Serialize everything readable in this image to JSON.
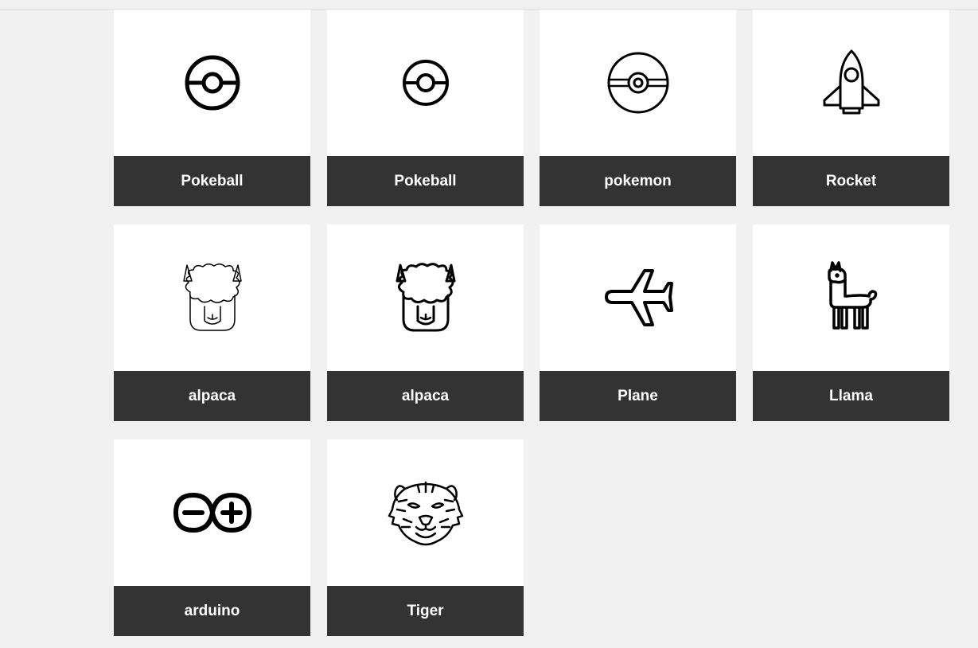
{
  "icons": [
    {
      "name": "Pokeball",
      "icon": "pokeball-icon"
    },
    {
      "name": "Pokeball",
      "icon": "pokeball-thin-icon"
    },
    {
      "name": "pokemon",
      "icon": "pokemon-ball-icon"
    },
    {
      "name": "Rocket",
      "icon": "rocket-icon"
    },
    {
      "name": "alpaca",
      "icon": "alpaca-thin-icon"
    },
    {
      "name": "alpaca",
      "icon": "alpaca-icon"
    },
    {
      "name": "Plane",
      "icon": "plane-icon"
    },
    {
      "name": "Llama",
      "icon": "llama-icon"
    },
    {
      "name": "arduino",
      "icon": "arduino-icon"
    },
    {
      "name": "Tiger",
      "icon": "tiger-icon"
    }
  ],
  "colors": {
    "background": "#f1f1f1",
    "card": "#ffffff",
    "label_bar": "#333333",
    "label_text": "#ffffff"
  }
}
